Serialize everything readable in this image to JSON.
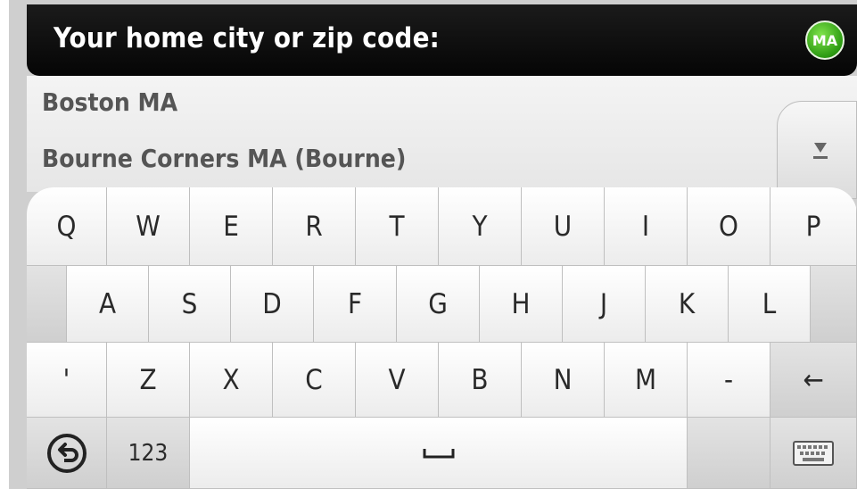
{
  "header": {
    "title": "Your home city or zip code:",
    "region_badge": "MA"
  },
  "suggestions": [
    "Boston MA",
    "Bourne Corners MA (Bourne)"
  ],
  "scroll_button_icon": "arrow-down-to-line-icon",
  "keyboard": {
    "row1": [
      "Q",
      "W",
      "E",
      "R",
      "T",
      "Y",
      "U",
      "I",
      "O",
      "P"
    ],
    "row2": [
      "A",
      "S",
      "D",
      "F",
      "G",
      "H",
      "J",
      "K",
      "L"
    ],
    "row3": [
      "'",
      "Z",
      "X",
      "C",
      "V",
      "B",
      "N",
      "M",
      "-"
    ],
    "backspace_label": "←",
    "back_icon": "back-circle-icon",
    "numbers_label": "123",
    "space_label": "␣",
    "keyboard_icon": "keyboard-icon"
  },
  "colors": {
    "header": "#0a0a0a",
    "badge": "#3fb01c",
    "keyboard_bg": "#c9c9c9"
  }
}
